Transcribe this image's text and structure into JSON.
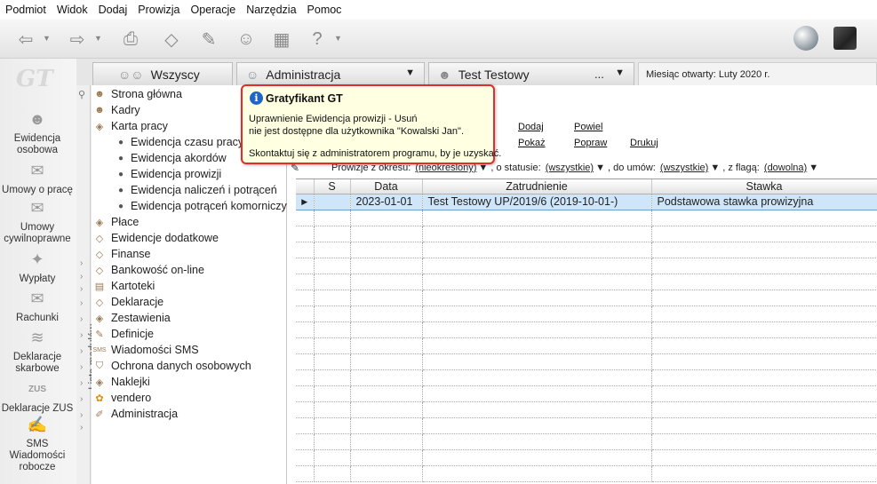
{
  "menu": [
    "Podmiot",
    "Widok",
    "Dodaj",
    "Prowizja",
    "Operacje",
    "Narzędzia",
    "Pomoc"
  ],
  "toolbar": {
    "icons": [
      "back-icon",
      "forward-icon",
      "print-icon",
      "eraser-icon",
      "tools-icon",
      "people-icon",
      "calculator-icon",
      "help-icon",
      "globe-icon",
      "cube-icon"
    ]
  },
  "logo": "GT",
  "tabs": {
    "all": "Wszyscy",
    "admin": "Administracja",
    "user": "Test Testowy",
    "user_more": "...",
    "month": "Miesiąc otwarty: Luty 2020 r."
  },
  "modules": [
    {
      "label1": "Ewidencja",
      "label2": "osobowa"
    },
    {
      "label1": "Umowy o pracę",
      "label2": ""
    },
    {
      "label1": "Umowy",
      "label2": "cywilnoprawne"
    },
    {
      "label1": "Wypłaty",
      "label2": ""
    },
    {
      "label1": "Rachunki",
      "label2": ""
    },
    {
      "label1": "Deklaracje",
      "label2": "skarbowe"
    },
    {
      "label1": "Deklaracje ZUS",
      "label2": ""
    },
    {
      "label1": "SMS",
      "label2": "Wiadomości",
      "label3": "robocze"
    }
  ],
  "module_list_label": "Lista modułów",
  "tree": {
    "items": [
      "Strona główna",
      "Kadry",
      "Karta pracy",
      "Ewidencja czasu pracy",
      "Ewidencja akordów",
      "Ewidencja prowizji",
      "Ewidencja naliczeń i potrąceń",
      "Ewidencja potrąceń komorniczy",
      "Płace",
      "Ewidencje dodatkowe",
      "Finanse",
      "Bankowość on-line",
      "Kartoteki",
      "Deklaracje",
      "Zestawienia",
      "Definicje",
      "Wiadomości SMS",
      "Ochrona danych osobowych",
      "Naklejki",
      "vendero",
      "Administracja"
    ]
  },
  "actions": {
    "add": "Dodaj",
    "repeat": "Powiel",
    "show": "Pokaż",
    "edit": "Popraw",
    "print": "Drukuj"
  },
  "filter": {
    "period_label": "Prowizje z okresu:",
    "period_value": "(nieokreślony)",
    "status_label": ", o statusie:",
    "status_value": "(wszystkie)",
    "contract_label": ", do umów:",
    "contract_value": "(wszystkie)",
    "flag_label": ", z flagą:",
    "flag_value": "(dowolna)"
  },
  "grid": {
    "headers": [
      "S",
      "Data",
      "Zatrudnienie",
      "Stawka"
    ],
    "rows": [
      {
        "s": "",
        "data": "2023-01-01",
        "zatrudnienie": "Test Testowy UP/2019/6 (2019-10-01-)",
        "stawka": "Podstawowa stawka prowizyjna"
      }
    ]
  },
  "tooltip": {
    "title": "Gratyfikant GT",
    "line1": "Uprawnienie Ewidencja prowizji - Usuń",
    "line2": "nie jest dostępne dla użytkownika \"Kowalski Jan\".",
    "line3": "Skontaktuj się z administratorem programu, by je uzyskać."
  },
  "colors": {
    "tooltip_border": "#e02d2d",
    "tooltip_bg": "#ffffe1",
    "selection": "#cfe6fa",
    "info": "#1f64c8"
  }
}
